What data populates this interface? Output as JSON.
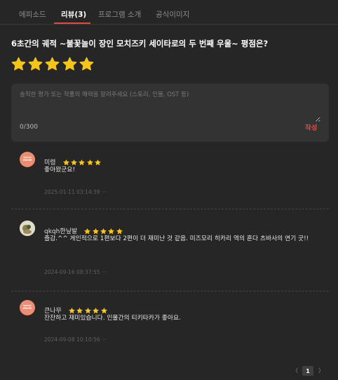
{
  "tabs": {
    "episodes": "에피소드",
    "reviews": "리뷰",
    "reviews_count": "(3)",
    "program_intro": "프로그램 소개",
    "official_images": "공식이미지"
  },
  "rating": {
    "question": "6초간의 궤적 ~불꽃놀이 장인 모치즈키 세이타로의 두 번째 우울~ 평점은?",
    "selected_stars": 5,
    "max_stars": 5
  },
  "review_form": {
    "placeholder": "솔직한 평가 또는 작품의 매력을 알려주세요 (스토리, 인물, OST 등)",
    "value": "",
    "counter": "0/300",
    "submit_label": "작성"
  },
  "reviews": [
    {
      "username": "미령",
      "stars": 5,
      "text": "좋아왔군요!",
      "date": "2025-01-11 03:14:39",
      "more": "···",
      "avatar": "wavve-logo"
    },
    {
      "username": "qkqh한닢발",
      "stars": 5,
      "text": "즐감.^^ 게인적으로 1편보다 2편이 더 재미난 것 같음. 미즈모리 히카리 역의 혼다 츠바사의 연기 굿!!",
      "date": "2024-09-16 08:37:55",
      "more": "···",
      "avatar": "user-photo"
    },
    {
      "username": "큰나무",
      "stars": 5,
      "text": "잔잔하고 재미있습니다. 인물간의 티키타카가 좋아요.",
      "date": "2024-09-08 10:10:56",
      "more": "···",
      "avatar": "wavve-logo"
    }
  ],
  "pagination": {
    "prev": "〈",
    "current": "1",
    "next": "〉"
  },
  "colors": {
    "background": "#262626",
    "accent": "#e24a3b",
    "star": "#f5c518",
    "input_bg": "#333333"
  }
}
